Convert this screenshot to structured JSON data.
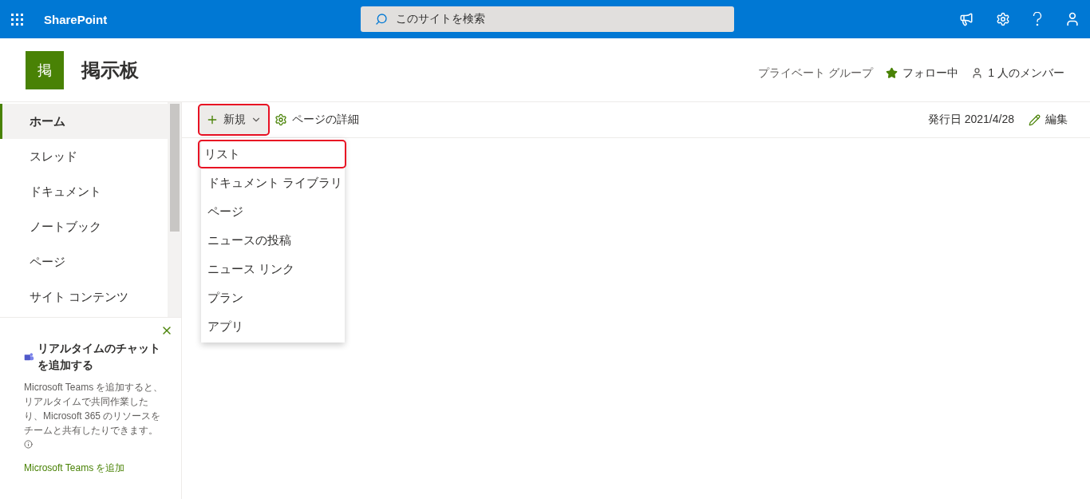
{
  "suite_bar": {
    "app_name": "SharePoint",
    "search": {
      "placeholder": "このサイトを検索"
    }
  },
  "site_header": {
    "logo_letter": "掲",
    "title": "掲示板",
    "privacy": "プライベート グループ",
    "follow": {
      "label": "フォロー中",
      "following": true
    },
    "members": "1 人のメンバー"
  },
  "nav": {
    "items": [
      {
        "label": "ホーム",
        "selected": true
      },
      {
        "label": "スレッド",
        "selected": false
      },
      {
        "label": "ドキュメント",
        "selected": false
      },
      {
        "label": "ノートブック",
        "selected": false
      },
      {
        "label": "ページ",
        "selected": false
      },
      {
        "label": "サイト コンテンツ",
        "selected": false
      }
    ]
  },
  "teams_card": {
    "title": "リアルタイムのチャットを追加する",
    "body": "Microsoft Teams を追加すると、リアルタイムで共同作業したり、Microsoft 365 のリソースをチームと共有したりできます。",
    "link": "Microsoft Teams を追加"
  },
  "command_bar": {
    "new_button": {
      "label": "新規",
      "highlighted": true
    },
    "page_details": "ページの詳細",
    "published": "発行日 2021/4/28",
    "edit": "編集"
  },
  "new_menu": {
    "items": [
      {
        "label": "リスト",
        "highlighted": true
      },
      {
        "label": "ドキュメント ライブラリ",
        "highlighted": false
      },
      {
        "label": "ページ",
        "highlighted": false
      },
      {
        "label": "ニュースの投稿",
        "highlighted": false
      },
      {
        "label": "ニュース リンク",
        "highlighted": false
      },
      {
        "label": "プラン",
        "highlighted": false
      },
      {
        "label": "アプリ",
        "highlighted": false
      }
    ]
  }
}
